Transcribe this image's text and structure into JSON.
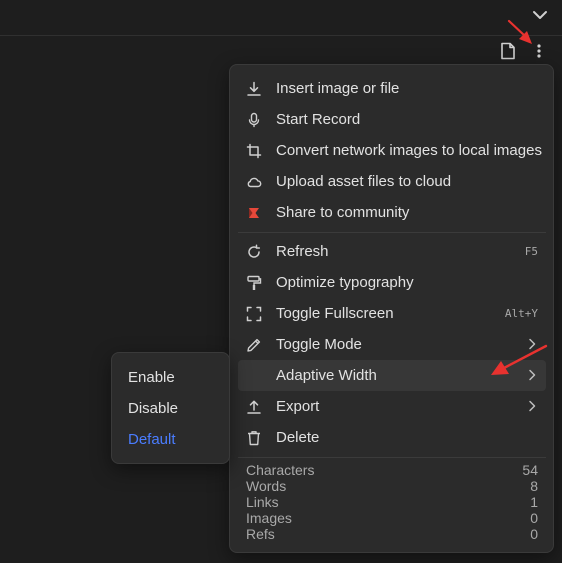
{
  "colors": {
    "background": "#1e1e1e",
    "menu_bg": "#2b2b2b",
    "hover_bg": "#373737",
    "text": "#e2e2e2",
    "muted": "#a9a9a9",
    "accent_blue": "#4a7dff",
    "annotation_red": "#e8322f",
    "community_icon_red": "#e5483a"
  },
  "toolbar": {
    "icons": [
      "chevron-down-icon",
      "document-icon",
      "more-vertical-icon"
    ]
  },
  "menu": {
    "items": [
      {
        "label": "Insert image or file",
        "icon": "download-icon"
      },
      {
        "label": "Start Record",
        "icon": "microphone-icon"
      },
      {
        "label": "Convert network images to local images",
        "icon": "crop-icon"
      },
      {
        "label": "Upload asset files to cloud",
        "icon": "cloud-icon"
      },
      {
        "label": "Share to community",
        "icon": "community-icon"
      },
      {
        "label": "Refresh",
        "icon": "refresh-icon",
        "shortcut": "F5"
      },
      {
        "label": "Optimize typography",
        "icon": "paint-roller-icon"
      },
      {
        "label": "Toggle Fullscreen",
        "icon": "fullscreen-icon",
        "shortcut": "Alt+Y"
      },
      {
        "label": "Toggle Mode",
        "icon": "pencil-icon",
        "submenu": true
      },
      {
        "label": "Adaptive Width",
        "icon": "",
        "submenu": true,
        "hover": true
      },
      {
        "label": "Export",
        "icon": "upload-icon",
        "submenu": true
      },
      {
        "label": "Delete",
        "icon": "trash-icon"
      }
    ],
    "stats": [
      {
        "label": "Characters",
        "value": "54"
      },
      {
        "label": "Words",
        "value": "8"
      },
      {
        "label": "Links",
        "value": "1"
      },
      {
        "label": "Images",
        "value": "0"
      },
      {
        "label": "Refs",
        "value": "0"
      }
    ]
  },
  "submenu": {
    "items": [
      {
        "label": "Enable"
      },
      {
        "label": "Disable"
      },
      {
        "label": "Default",
        "active": true
      }
    ]
  }
}
